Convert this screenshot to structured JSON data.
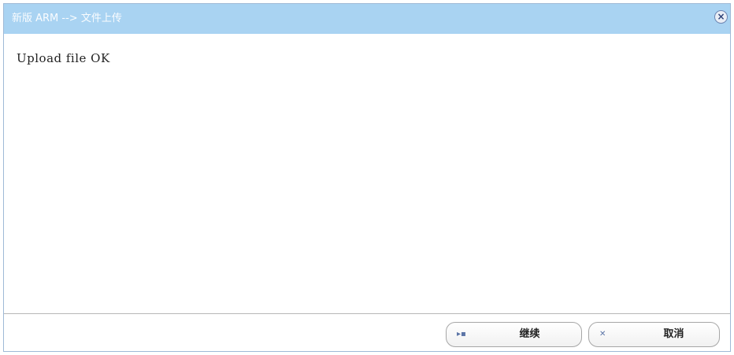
{
  "dialog": {
    "title": "新版 ARM --> 文件上传",
    "close_icon": "close-icon",
    "message": "Upload file OK"
  },
  "footer": {
    "continue_label": "继续",
    "continue_icon": "arrow-right-icon",
    "cancel_label": "取消",
    "cancel_icon": "close-x-icon"
  },
  "colors": {
    "titlebar_bg": "#a9d3f2",
    "close_border": "#6d86b3"
  }
}
